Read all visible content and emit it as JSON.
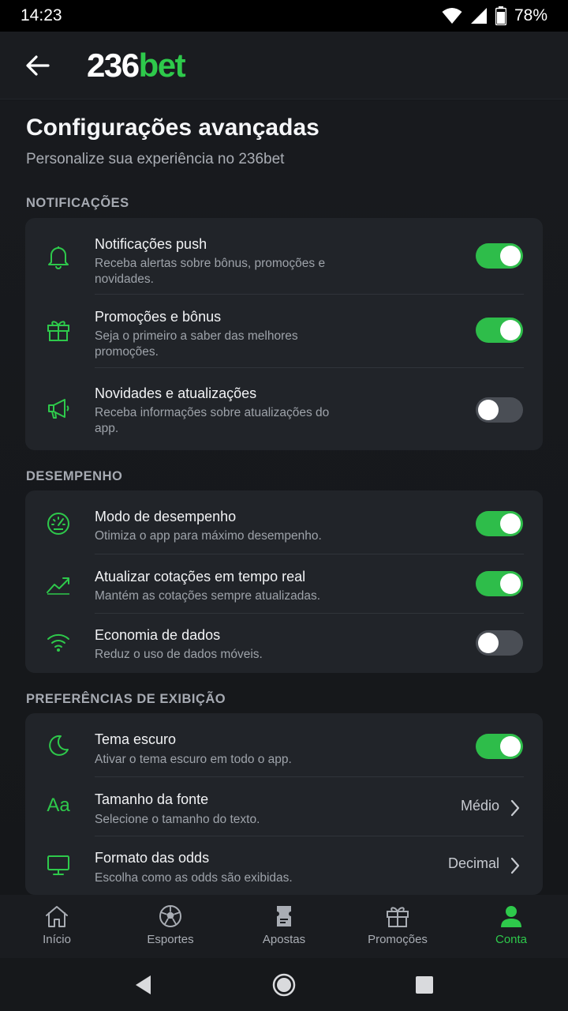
{
  "status_bar": {
    "time": "14:23",
    "battery": "78%"
  },
  "header": {
    "logo_number": "236",
    "logo_bet": "bet"
  },
  "page": {
    "title": "Configurações avançadas",
    "subtitle": "Personalize sua experiência no 236bet"
  },
  "sections": [
    {
      "label": "NOTIFICAÇÕES",
      "rows": [
        {
          "icon": "bell-icon",
          "title": "Notificações push",
          "desc": "Receba alertas sobre bônus, promoções e novidades.",
          "toggle": true
        },
        {
          "icon": "gift-icon",
          "title": "Promoções e bônus",
          "desc": "Seja o primeiro a saber das melhores promoções.",
          "toggle": true
        },
        {
          "icon": "megaphone-icon",
          "title": "Novidades e atualizações",
          "desc": "Receba informações sobre atualizações do app.",
          "toggle": false
        }
      ]
    },
    {
      "label": "DESEMPENHO",
      "rows": [
        {
          "icon": "speedometer-icon",
          "title": "Modo de desempenho",
          "desc": "Otimiza o app para máximo desempenho.",
          "toggle": true
        },
        {
          "icon": "trending-up-icon",
          "title": "Atualizar cotações em tempo real",
          "desc": "Mantém as cotações sempre atualizadas.",
          "toggle": true
        },
        {
          "icon": "wifi-icon",
          "title": "Economia de dados",
          "desc": "Reduz o uso de dados móveis.",
          "toggle": false
        }
      ]
    },
    {
      "label": "PREFERÊNCIAS DE EXIBIÇÃO",
      "rows": [
        {
          "icon": "moon-icon",
          "title": "Tema escuro",
          "desc": "Ativar o tema escuro em todo o app.",
          "toggle": true
        },
        {
          "icon": "font-size-icon",
          "icon_text": "Aa",
          "title": "Tamanho da fonte",
          "desc": "Selecione o tamanho do texto.",
          "value": "Médio"
        },
        {
          "icon": "monitor-icon",
          "title": "Formato das odds",
          "desc": "Escolha como as odds são exibidas.",
          "value": "Decimal"
        }
      ]
    }
  ],
  "bottom_nav": [
    {
      "icon": "home-icon",
      "label": "Início",
      "active": false
    },
    {
      "icon": "soccer-ball-icon",
      "label": "Esportes",
      "active": false
    },
    {
      "icon": "ticket-icon",
      "label": "Apostas",
      "active": false
    },
    {
      "icon": "gift-icon",
      "label": "Promoções",
      "active": false
    },
    {
      "icon": "user-icon",
      "label": "Conta",
      "active": true
    }
  ],
  "colors": {
    "accent": "#2ec94b",
    "background": "#14161a",
    "card": "#212429",
    "toggle_off": "#4a4e55"
  }
}
